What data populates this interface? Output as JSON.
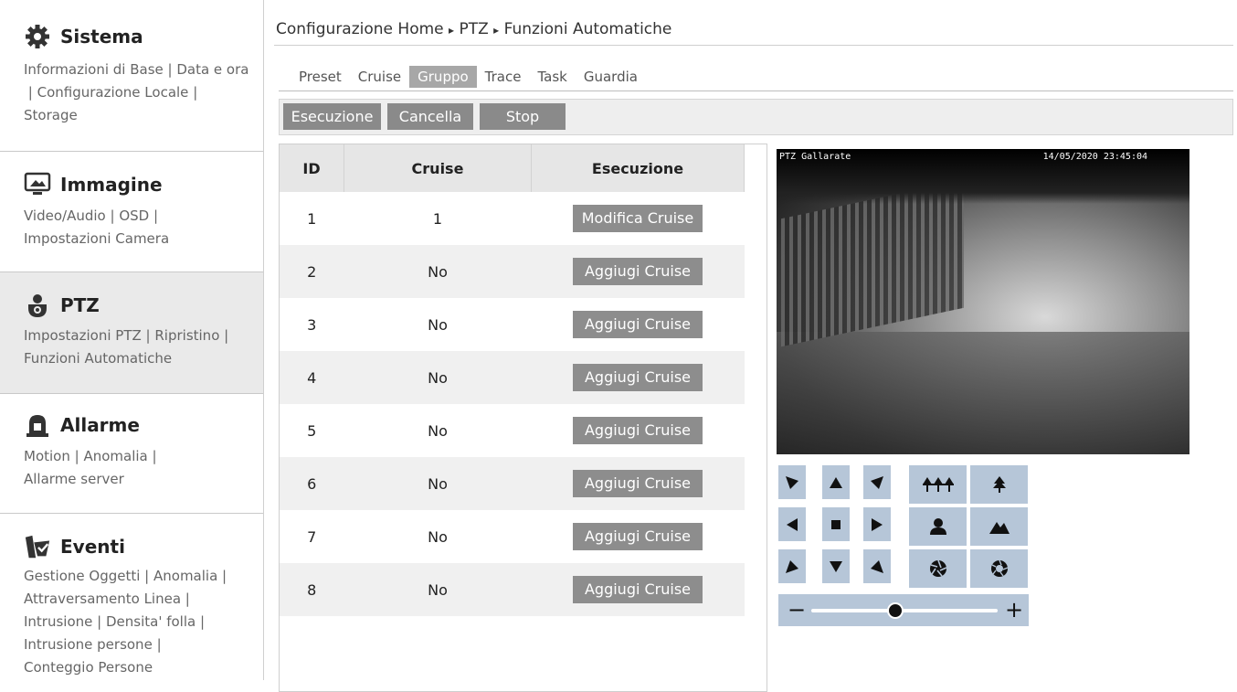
{
  "sidebar": {
    "sistema": {
      "title": "Sistema",
      "links": [
        "Informazioni di Base",
        "Data e ora",
        "Configurazione Locale",
        "Storage"
      ]
    },
    "immagine": {
      "title": "Immagine",
      "links": [
        "Video/Audio",
        "OSD",
        "Impostazioni Camera"
      ]
    },
    "ptz": {
      "title": "PTZ",
      "links": [
        "Impostazioni PTZ",
        "Ripristino",
        "Funzioni Automatiche"
      ]
    },
    "allarme": {
      "title": "Allarme",
      "links": [
        "Motion",
        "Anomalia",
        "Allarme server"
      ]
    },
    "eventi": {
      "title": "Eventi",
      "links": [
        "Gestione Oggetti",
        "Anomalia",
        "Attraversamento Linea",
        "Intrusione",
        "Densita' folla",
        "Intrusione persone",
        "Conteggio Persone"
      ]
    }
  },
  "breadcrumb": {
    "home": "Configurazione Home",
    "sep": "▸",
    "ptz": "PTZ",
    "page": "Funzioni Automatiche"
  },
  "tabs": {
    "preset": "Preset",
    "cruise": "Cruise",
    "gruppo": "Gruppo",
    "trace": "Trace",
    "task": "Task",
    "guardia": "Guardia",
    "active": "Gruppo"
  },
  "toolbar": {
    "esecuzione": "Esecuzione",
    "cancella": "Cancella",
    "stop": "Stop"
  },
  "table": {
    "headers": {
      "id": "ID",
      "cruise": "Cruise",
      "esecuzione": "Esecuzione"
    },
    "rows": [
      {
        "id": "1",
        "cruise": "1",
        "action": "Modifica Cruise"
      },
      {
        "id": "2",
        "cruise": "No",
        "action": "Aggiugi Cruise"
      },
      {
        "id": "3",
        "cruise": "No",
        "action": "Aggiugi Cruise"
      },
      {
        "id": "4",
        "cruise": "No",
        "action": "Aggiugi Cruise"
      },
      {
        "id": "5",
        "cruise": "No",
        "action": "Aggiugi Cruise"
      },
      {
        "id": "6",
        "cruise": "No",
        "action": "Aggiugi Cruise"
      },
      {
        "id": "7",
        "cruise": "No",
        "action": "Aggiugi Cruise"
      },
      {
        "id": "8",
        "cruise": "No",
        "action": "Aggiugi Cruise"
      }
    ]
  },
  "video": {
    "camera_name": "PTZ Gallarate",
    "timestamp": "14/05/2020 23:45:04"
  },
  "ptz": {
    "zoom_out": "−",
    "zoom_in": "+",
    "zoom_level": 0.45
  },
  "colors": {
    "pad_bg": "#b6c6d8",
    "button_bg": "#8d8d8d",
    "active_tab": "#a7a7a7"
  }
}
